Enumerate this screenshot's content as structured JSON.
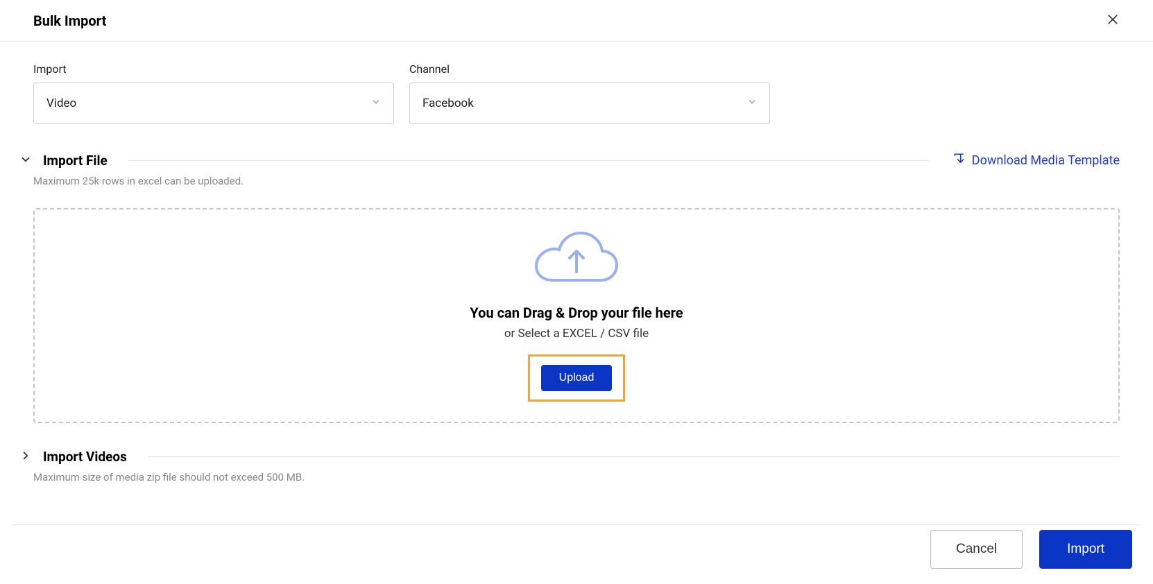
{
  "header": {
    "title": "Bulk Import"
  },
  "filters": {
    "import_label": "Import",
    "import_value": "Video",
    "channel_label": "Channel",
    "channel_value": "Facebook"
  },
  "section_file": {
    "title": "Import File",
    "subtitle": "Maximum 25k rows in excel can be uploaded.",
    "download_link": "Download Media Template",
    "drop_title": "You can Drag & Drop your file here",
    "drop_sub": "or Select a EXCEL / CSV file",
    "upload_btn": "Upload"
  },
  "section_videos": {
    "title": "Import Videos",
    "subtitle": "Maximum size of media zip file should not exceed 500 MB."
  },
  "footer": {
    "cancel": "Cancel",
    "import": "Import"
  }
}
